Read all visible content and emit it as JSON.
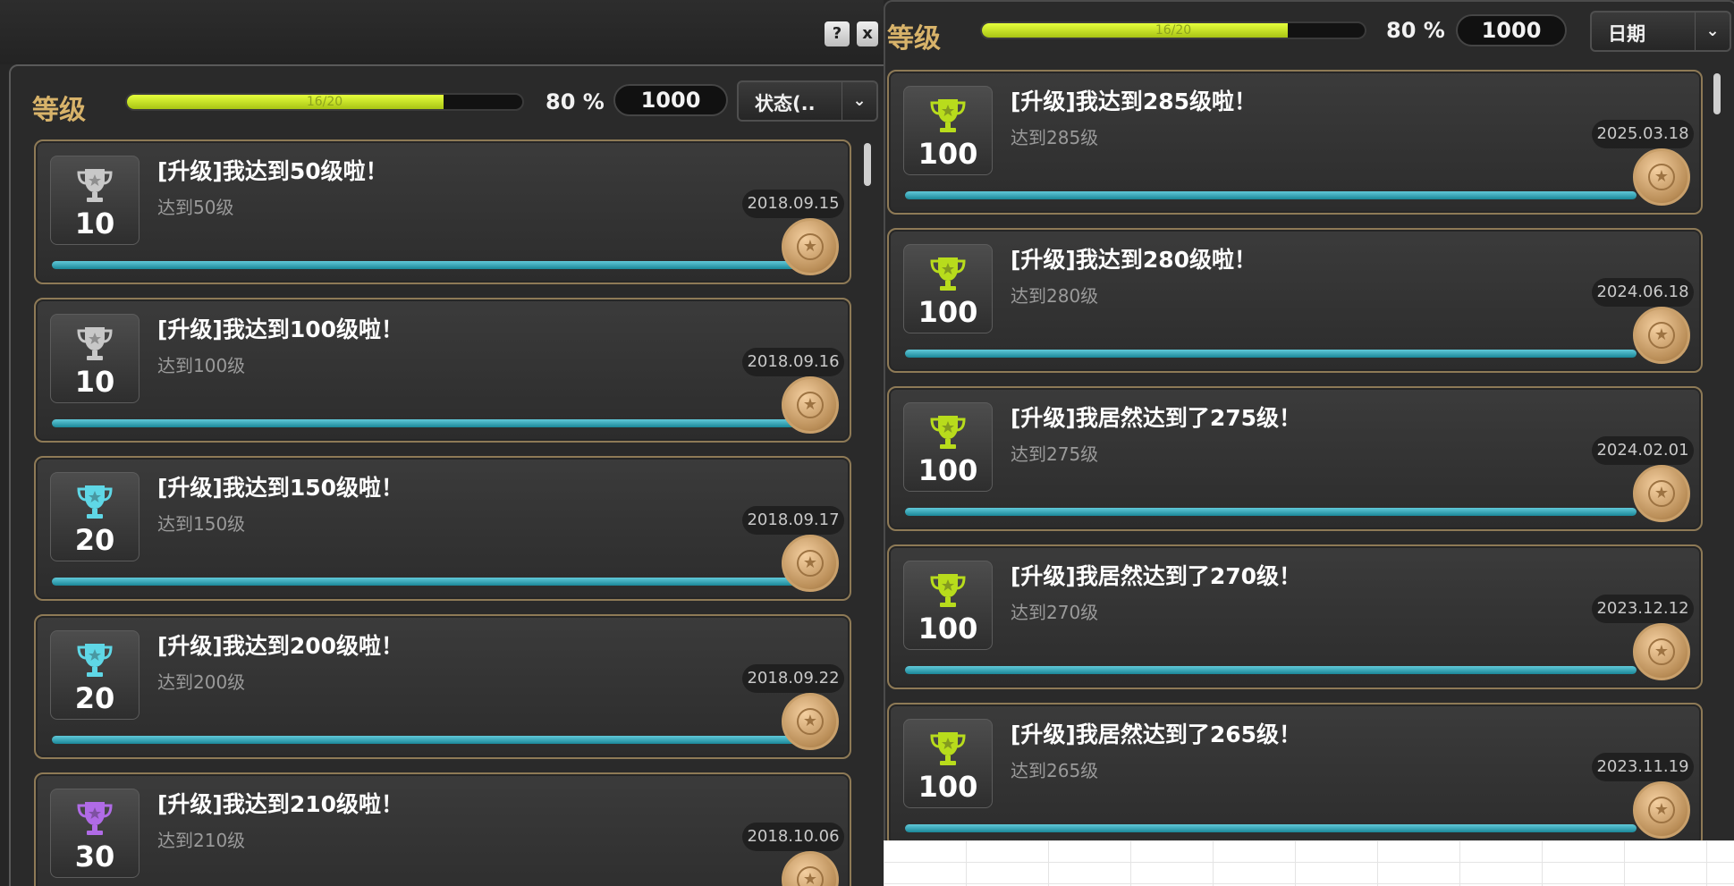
{
  "left": {
    "window_buttons": {
      "help": "?",
      "close": "x"
    },
    "level_label": "等级",
    "progress": {
      "label": "16/20",
      "value": 0.8,
      "percent": "80 %"
    },
    "points": "1000",
    "sort": {
      "value": "状态(.."
    },
    "cards": [
      {
        "title": "[升级]我达到50级啦！",
        "subtitle": "达到50级",
        "date": "2018.09.15",
        "points": "10",
        "trophy": "silver"
      },
      {
        "title": "[升级]我达到100级啦！",
        "subtitle": "达到100级",
        "date": "2018.09.16",
        "points": "10",
        "trophy": "silver"
      },
      {
        "title": "[升级]我达到150级啦！",
        "subtitle": "达到150级",
        "date": "2018.09.17",
        "points": "20",
        "trophy": "cyan"
      },
      {
        "title": "[升级]我达到200级啦！",
        "subtitle": "达到200级",
        "date": "2018.09.22",
        "points": "20",
        "trophy": "cyan"
      },
      {
        "title": "[升级]我达到210级啦！",
        "subtitle": "达到210级",
        "date": "2018.10.06",
        "points": "30",
        "trophy": "purple"
      }
    ]
  },
  "right": {
    "level_label": "等级",
    "progress": {
      "label": "16/20",
      "value": 0.8,
      "percent": "80 %"
    },
    "points": "1000",
    "sort": {
      "value": "日期"
    },
    "cards": [
      {
        "title": "[升级]我达到285级啦！",
        "subtitle": "达到285级",
        "date": "2025.03.18",
        "points": "100",
        "trophy": "green"
      },
      {
        "title": "[升级]我达到280级啦！",
        "subtitle": "达到280级",
        "date": "2024.06.18",
        "points": "100",
        "trophy": "green"
      },
      {
        "title": "[升级]我居然达到了275级！",
        "subtitle": "达到275级",
        "date": "2024.02.01",
        "points": "100",
        "trophy": "green"
      },
      {
        "title": "[升级]我居然达到了270级！",
        "subtitle": "达到270级",
        "date": "2023.12.12",
        "points": "100",
        "trophy": "green"
      },
      {
        "title": "[升级]我居然达到了265级！",
        "subtitle": "达到265级",
        "date": "2023.11.19",
        "points": "100",
        "trophy": "green"
      }
    ]
  },
  "colors": {
    "silver": "#c8c8c8",
    "cyan": "#5fd7e6",
    "purple": "#b06be6",
    "green": "#b8dc1c",
    "card_border": "#8e7a56",
    "progress_fill": "#d7f13a"
  }
}
